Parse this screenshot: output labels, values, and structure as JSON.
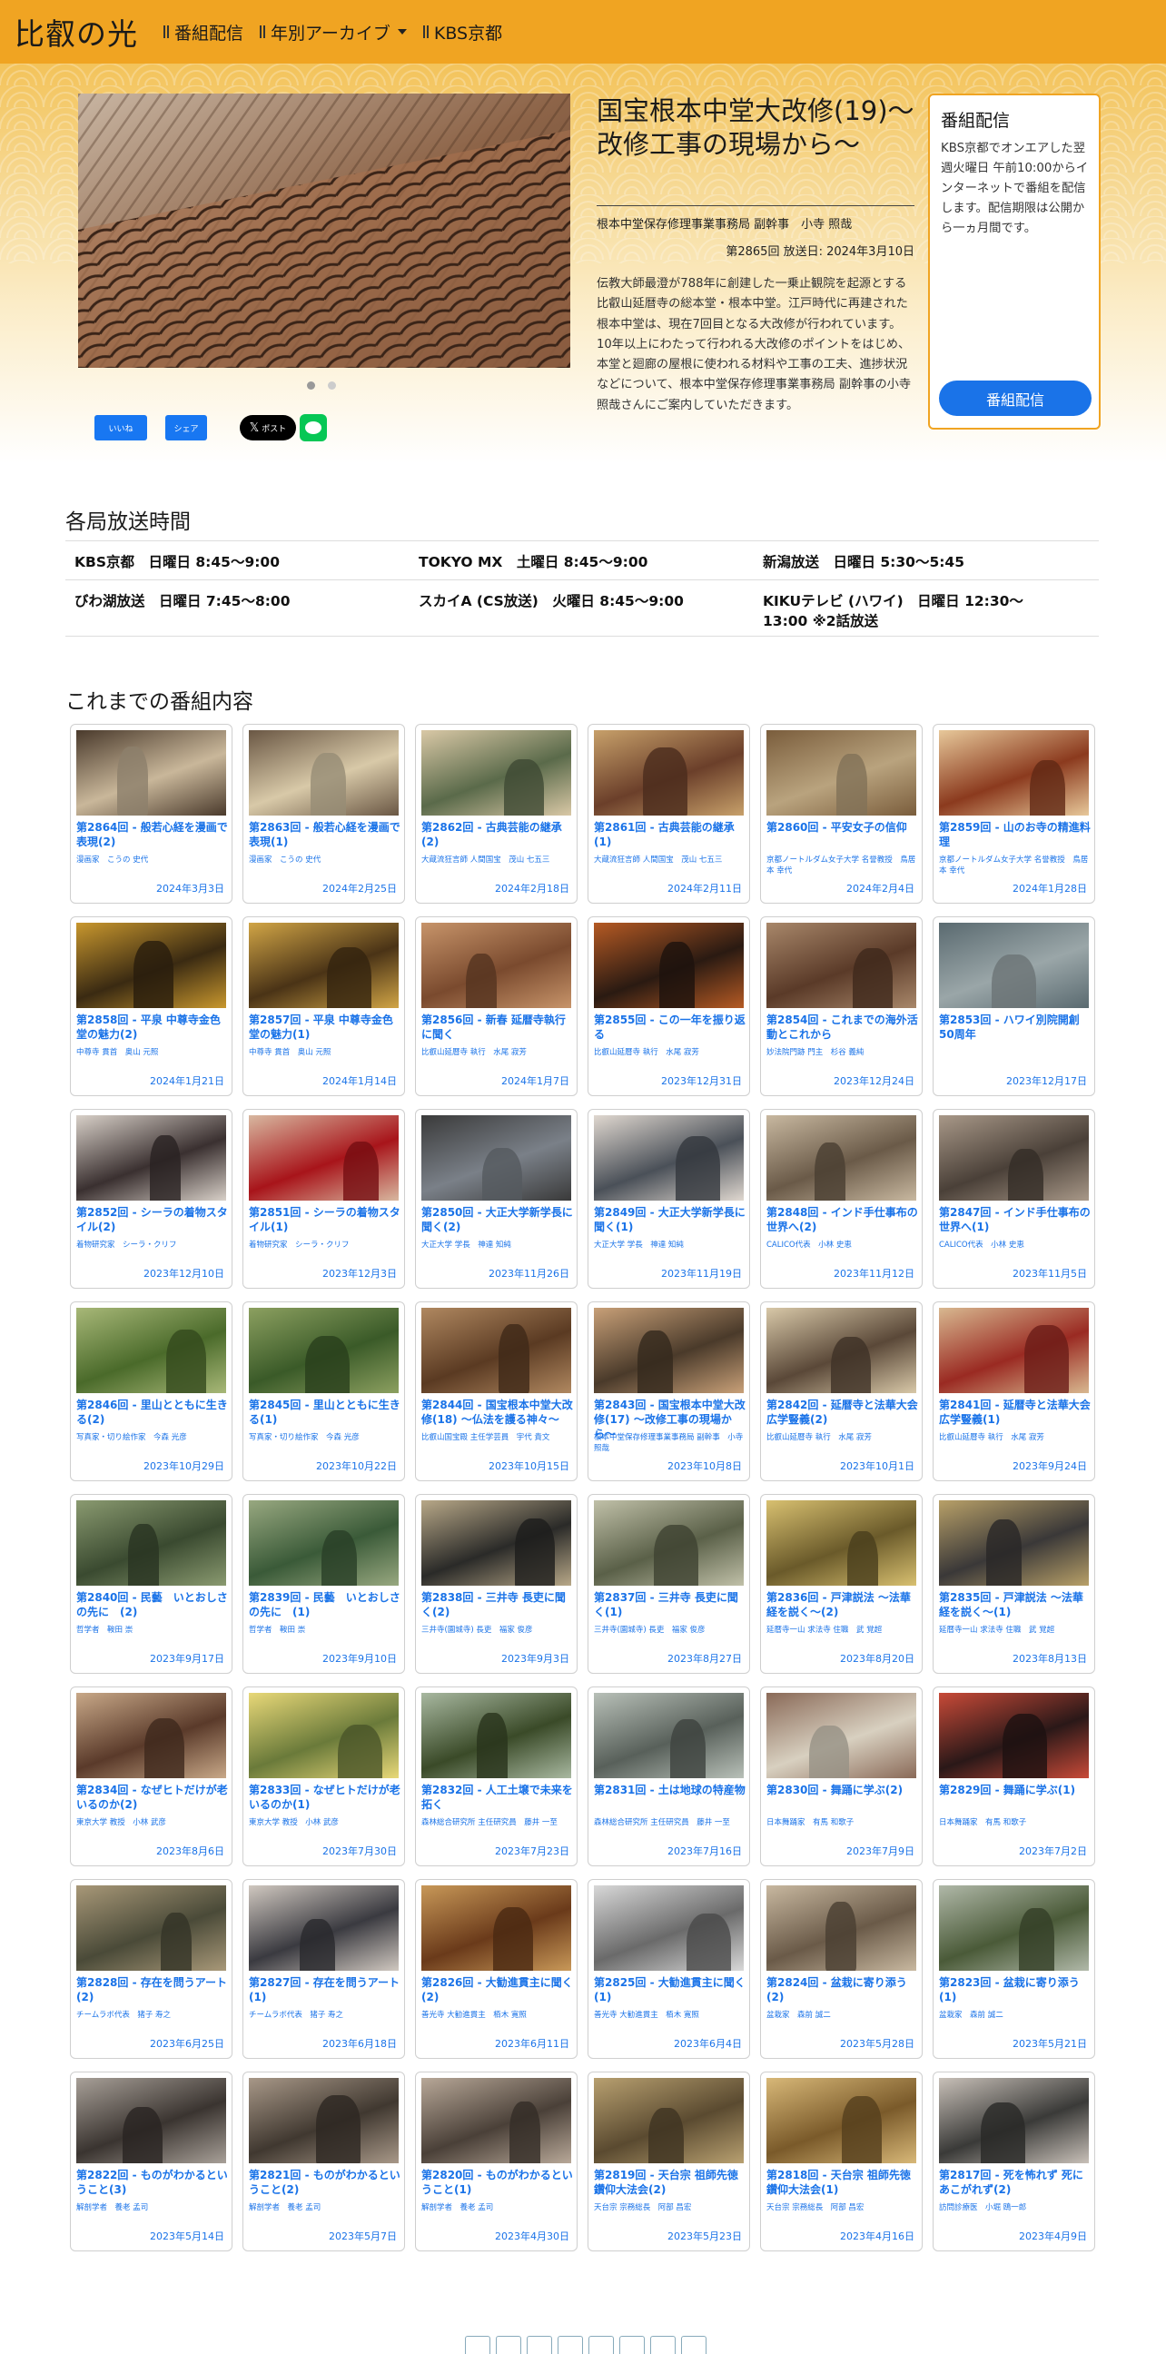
{
  "nav": {
    "brand": "比叡の光",
    "links": [
      "番組配信",
      "年別アーカイブ",
      "KBS京都"
    ]
  },
  "hero": {
    "title": "国宝根本中堂大改修(19)〜改修工事の現場から〜",
    "guest": "根本中堂保存修理事業事務局 副幹事　小寺 照哉",
    "air": "第2865回 放送日: 2024年3月10日",
    "description": "伝教大師最澄が788年に創建した一乗止観院を起源とする比叡山延暦寺の総本堂・根本中堂。江戸時代に再建された根本中堂は、現在7回目となる大改修が行われています。10年以上にわたって行われる大改修のポイントをはじめ、本堂と廻廊の屋根に使われる材料や工事の工夫、進捗状況などについて、根本中堂保存修理事業事務局 副幹事の小寺照哉さんにご案内していただきます。",
    "share": [
      "いいね",
      "シェア",
      "ポスト"
    ]
  },
  "broadcast": {
    "title": "番組配信",
    "text": "KBS京都でオンエアした翌週火曜日 午前10:00からインターネットで番組を配信します。配信期限は公開から一ヵ月間です。",
    "button": "番組配信"
  },
  "stations": {
    "title": "各局放送時間",
    "rows": [
      [
        "KBS京都　日曜日 8:45〜9:00",
        "TOKYO MX　土曜日 8:45〜9:00",
        "新潟放送　日曜日 5:30〜5:45"
      ],
      [
        "びわ湖放送　日曜日 7:45〜8:00",
        "スカイA (CS放送)　火曜日 8:45〜9:00",
        "KIKUテレビ (ハワイ)　日曜日 12:30〜13:00 ※2話放送"
      ]
    ]
  },
  "episodes": {
    "title": "これまでの番組内容",
    "items": [
      {
        "title": "第2864回 - 般若心経を漫画で表現(2)",
        "guest": "漫画家　こうの 史代",
        "date": "2024年3月3日"
      },
      {
        "title": "第2863回 - 般若心経を漫画で表現(1)",
        "guest": "漫画家　こうの 史代",
        "date": "2024年2月25日"
      },
      {
        "title": "第2862回 - 古典芸能の継承(2)",
        "guest": "大蔵流狂言師 人間国宝　茂山 七五三",
        "date": "2024年2月18日"
      },
      {
        "title": "第2861回 - 古典芸能の継承(1)",
        "guest": "大蔵流狂言師 人間国宝　茂山 七五三",
        "date": "2024年2月11日"
      },
      {
        "title": "第2860回 - 平安女子の信仰",
        "guest": "京都ノートルダム女子大学 名誉教授　鳥居本 幸代",
        "date": "2024年2月4日"
      },
      {
        "title": "第2859回 - 山のお寺の精進料理",
        "guest": "京都ノートルダム女子大学 名誉教授　鳥居本 幸代",
        "date": "2024年1月28日"
      },
      {
        "title": "第2858回 - 平泉 中尊寺金色堂の魅力(2)",
        "guest": "中尊寺 貫首　奥山 元照",
        "date": "2024年1月21日"
      },
      {
        "title": "第2857回 - 平泉 中尊寺金色堂の魅力(1)",
        "guest": "中尊寺 貫首　奥山 元照",
        "date": "2024年1月14日"
      },
      {
        "title": "第2856回 - 新春 延暦寺執行に聞く",
        "guest": "比叡山延暦寺 執行　水尾 寂芳",
        "date": "2024年1月7日"
      },
      {
        "title": "第2855回 - この一年を振り返る",
        "guest": "比叡山延暦寺 執行　水尾 寂芳",
        "date": "2023年12月31日"
      },
      {
        "title": "第2854回 - これまでの海外活動とこれから",
        "guest": "妙法院門跡 門主　杉谷 義純",
        "date": "2023年12月24日"
      },
      {
        "title": "第2853回 - ハワイ別院開創50周年",
        "guest": "",
        "date": "2023年12月17日"
      },
      {
        "title": "第2852回 - シーラの着物スタイル(2)",
        "guest": "着物研究家　シーラ・クリフ",
        "date": "2023年12月10日"
      },
      {
        "title": "第2851回 - シーラの着物スタイル(1)",
        "guest": "着物研究家　シーラ・クリフ",
        "date": "2023年12月3日"
      },
      {
        "title": "第2850回 - 大正大学新学長に聞く(2)",
        "guest": "大正大学 学長　神達 知純",
        "date": "2023年11月26日"
      },
      {
        "title": "第2849回 - 大正大学新学長に聞く(1)",
        "guest": "大正大学 学長　神達 知純",
        "date": "2023年11月19日"
      },
      {
        "title": "第2848回 - インド手仕事布の世界へ(2)",
        "guest": "CALICO代表　小林 史恵",
        "date": "2023年11月12日"
      },
      {
        "title": "第2847回 - インド手仕事布の世界へ(1)",
        "guest": "CALICO代表　小林 史恵",
        "date": "2023年11月5日"
      },
      {
        "title": "第2846回 - 里山とともに生きる(2)",
        "guest": "写真家・切り絵作家　今森 光彦",
        "date": "2023年10月29日"
      },
      {
        "title": "第2845回 - 里山とともに生きる(1)",
        "guest": "写真家・切り絵作家　今森 光彦",
        "date": "2023年10月22日"
      },
      {
        "title": "第2844回 - 国宝根本中堂大改修(18) 〜仏法を護る神々〜",
        "guest": "比叡山国宝殿 主任学芸員　宇代 貴文",
        "date": "2023年10月15日"
      },
      {
        "title": "第2843回 - 国宝根本中堂大改修(17) 〜改修工事の現場から〜",
        "guest": "根本中堂保存修理事業事務局 副幹事　小寺 照哉",
        "date": "2023年10月8日"
      },
      {
        "title": "第2842回 - 延暦寺と法華大会広学豎義(2)",
        "guest": "比叡山延暦寺 執行　水尾 寂芳",
        "date": "2023年10月1日"
      },
      {
        "title": "第2841回 - 延暦寺と法華大会広学豎義(1)",
        "guest": "比叡山延暦寺 執行　水尾 寂芳",
        "date": "2023年9月24日"
      },
      {
        "title": "第2840回 - 民藝　いとおしさの先に　(2)",
        "guest": "哲学者　鞍田 崇",
        "date": "2023年9月17日"
      },
      {
        "title": "第2839回 - 民藝　いとおしさの先に　(1)",
        "guest": "哲学者　鞍田 崇",
        "date": "2023年9月10日"
      },
      {
        "title": "第2838回 - 三井寺 長吏に聞く(2)",
        "guest": "三井寺(園城寺) 長吏　福家 俊彦",
        "date": "2023年9月3日"
      },
      {
        "title": "第2837回 - 三井寺 長吏に聞く(1)",
        "guest": "三井寺(園城寺) 長吏　福家 俊彦",
        "date": "2023年8月27日"
      },
      {
        "title": "第2836回 - 戸津説法 〜法華経を説く〜(2)",
        "guest": "延暦寺一山 求法寺 住職　武 覚超",
        "date": "2023年8月20日"
      },
      {
        "title": "第2835回 - 戸津説法 〜法華経を説く〜(1)",
        "guest": "延暦寺一山 求法寺 住職　武 覚超",
        "date": "2023年8月13日"
      },
      {
        "title": "第2834回 - なぜヒトだけが老いるのか(2)",
        "guest": "東京大学 教授　小林 武彦",
        "date": "2023年8月6日"
      },
      {
        "title": "第2833回 - なぜヒトだけが老いるのか(1)",
        "guest": "東京大学 教授　小林 武彦",
        "date": "2023年7月30日"
      },
      {
        "title": "第2832回 - 人工土壌で未来を拓く",
        "guest": "森林総合研究所 主任研究員　藤井 一至",
        "date": "2023年7月23日"
      },
      {
        "title": "第2831回 - 土は地球の特産物",
        "guest": "森林総合研究所 主任研究員　藤井 一至",
        "date": "2023年7月16日"
      },
      {
        "title": "第2830回 - 舞踊に学ぶ(2)",
        "guest": "日本舞踊家　有馬 和歌子",
        "date": "2023年7月9日"
      },
      {
        "title": "第2829回 - 舞踊に学ぶ(1)",
        "guest": "日本舞踊家　有馬 和歌子",
        "date": "2023年7月2日"
      },
      {
        "title": "第2828回 - 存在を問うアート(2)",
        "guest": "チームラボ代表　猪子 寿之",
        "date": "2023年6月25日"
      },
      {
        "title": "第2827回 - 存在を問うアート(1)",
        "guest": "チームラボ代表　猪子 寿之",
        "date": "2023年6月18日"
      },
      {
        "title": "第2826回 - 大勧進貫主に聞く(2)",
        "guest": "善光寺 大勧進貫主　栢木 寛照",
        "date": "2023年6月11日"
      },
      {
        "title": "第2825回 - 大勧進貫主に聞く(1)",
        "guest": "善光寺 大勧進貫主　栢木 寛照",
        "date": "2023年6月4日"
      },
      {
        "title": "第2824回 - 盆栽に寄り添う(2)",
        "guest": "盆栽家　森前 誠二",
        "date": "2023年5月28日"
      },
      {
        "title": "第2823回 - 盆栽に寄り添う(1)",
        "guest": "盆栽家　森前 誠二",
        "date": "2023年5月21日"
      },
      {
        "title": "第2822回 - ものがわかるということ(3)",
        "guest": "解剖学者　養老 孟司",
        "date": "2023年5月14日"
      },
      {
        "title": "第2821回 - ものがわかるということ(2)",
        "guest": "解剖学者　養老 孟司",
        "date": "2023年5月7日"
      },
      {
        "title": "第2820回 - ものがわかるということ(1)",
        "guest": "解剖学者　養老 孟司",
        "date": "2023年4月30日"
      },
      {
        "title": "第2819回 - 天台宗 祖師先徳鑽仰大法会(2)",
        "guest": "天台宗 宗務総長　阿部 昌宏",
        "date": "2023年5月23日"
      },
      {
        "title": "第2818回 - 天台宗 祖師先徳鑽仰大法会(1)",
        "guest": "天台宗 宗務総長　阿部 昌宏",
        "date": "2023年4月16日"
      },
      {
        "title": "第2817回 - 死を怖れず 死にあこがれず(2)",
        "guest": "訪問診療医　小堀 鴎一郎",
        "date": "2023年4月9日"
      }
    ]
  },
  "thumb_palettes": [
    [
      "#c9b79a",
      "#4a3a2c"
    ],
    [
      "#d8c9a8",
      "#6a5744"
    ],
    [
      "#5a6a4a",
      "#d9c8a6"
    ],
    [
      "#6b3f2a",
      "#c7a06a"
    ],
    [
      "#b9a37e",
      "#7a5d3c"
    ],
    [
      "#8b3a1e",
      "#e7c89a"
    ],
    [
      "#3a2a12",
      "#c8972e"
    ],
    [
      "#4a3316",
      "#d1a546"
    ],
    [
      "#7a4a2e",
      "#c7946a"
    ],
    [
      "#2a1a12",
      "#b55a24"
    ],
    [
      "#5a3a28",
      "#a8876a"
    ],
    [
      "#9aa6a8",
      "#5a6a70"
    ],
    [
      "#3a3030",
      "#d8d0c8"
    ],
    [
      "#a8141a",
      "#d8b8a0"
    ],
    [
      "#7a8088",
      "#3a3a3a"
    ],
    [
      "#4a5058",
      "#e0d8d0"
    ],
    [
      "#6a5a48",
      "#c8b8a0"
    ],
    [
      "#4a4038",
      "#a89888"
    ],
    [
      "#4a6a2a",
      "#a8b878"
    ],
    [
      "#3a5a28",
      "#8ca060"
    ],
    [
      "#5a3a22",
      "#b08860"
    ],
    [
      "#4a3a2a",
      "#c8a078"
    ],
    [
      "#5a4838",
      "#d8c8a8"
    ],
    [
      "#9a2a22",
      "#d8b890"
    ],
    [
      "#3a4a30",
      "#8a9a70"
    ],
    [
      "#3a5a38",
      "#98a880"
    ],
    [
      "#2a2a28",
      "#b8a888"
    ],
    [
      "#5a6048",
      "#c0c0a8"
    ],
    [
      "#6a5a2a",
      "#d8c070"
    ],
    [
      "#3a3838",
      "#b8a068"
    ],
    [
      "#5a3a2a",
      "#c8a888"
    ],
    [
      "#6a7a3a",
      "#e8d878"
    ],
    [
      "#3a4a28",
      "#a8b8a0"
    ],
    [
      "#58605a",
      "#b8c0b8"
    ],
    [
      "#d8d0c0",
      "#8a6a58"
    ],
    [
      "#2a1818",
      "#c84a38"
    ],
    [
      "#4a4a38",
      "#a89878"
    ],
    [
      "#3a3a40",
      "#d0c8c0"
    ],
    [
      "#6a3a1a",
      "#c89858"
    ],
    [
      "#6a6a6a",
      "#d8d8d8"
    ],
    [
      "#6a5a48",
      "#c8b8a0"
    ],
    [
      "#4a5a38",
      "#b0b8a8"
    ],
    [
      "#3a3430",
      "#a8a098"
    ],
    [
      "#403830",
      "#a89888"
    ],
    [
      "#4a4038",
      "#b8a898"
    ],
    [
      "#5a4a30",
      "#b8a070"
    ],
    [
      "#7a5a2a",
      "#d8b878"
    ],
    [
      "#3a3a38",
      "#c8c0b8"
    ]
  ],
  "colors": {
    "accent": "#1a73e8",
    "nav": "#f0a422",
    "border": "#f0a422"
  }
}
